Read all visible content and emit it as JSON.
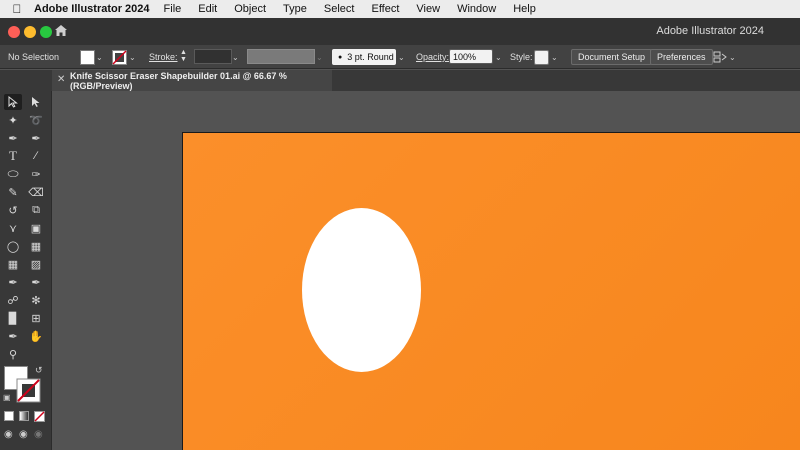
{
  "menubar": {
    "apple_icon": "apple-icon",
    "app_name": "Adobe Illustrator 2024",
    "menus": [
      "File",
      "Edit",
      "Object",
      "Type",
      "Select",
      "Effect",
      "View",
      "Window",
      "Help"
    ]
  },
  "titlebar": {
    "title": "Adobe Illustrator 2024",
    "colors": {
      "close": "#fe5f57",
      "minimize": "#febc2e",
      "zoom": "#28c840"
    }
  },
  "controlbar": {
    "selection": "No Selection",
    "stroke_label": "Stroke:",
    "brush": "3 pt. Round",
    "opacity_label": "Opacity:",
    "opacity_value": "100%",
    "style_label": "Style:",
    "document_setup": "Document Setup",
    "preferences": "Preferences"
  },
  "document": {
    "tab_title": "Knife Scissor Eraser Shapebuilder 01.ai @ 66.67 % (RGB/Preview)"
  },
  "artboard": {
    "background_color": "#f9891f",
    "shape": {
      "type": "ellipse",
      "fill": "#ffffff"
    }
  }
}
